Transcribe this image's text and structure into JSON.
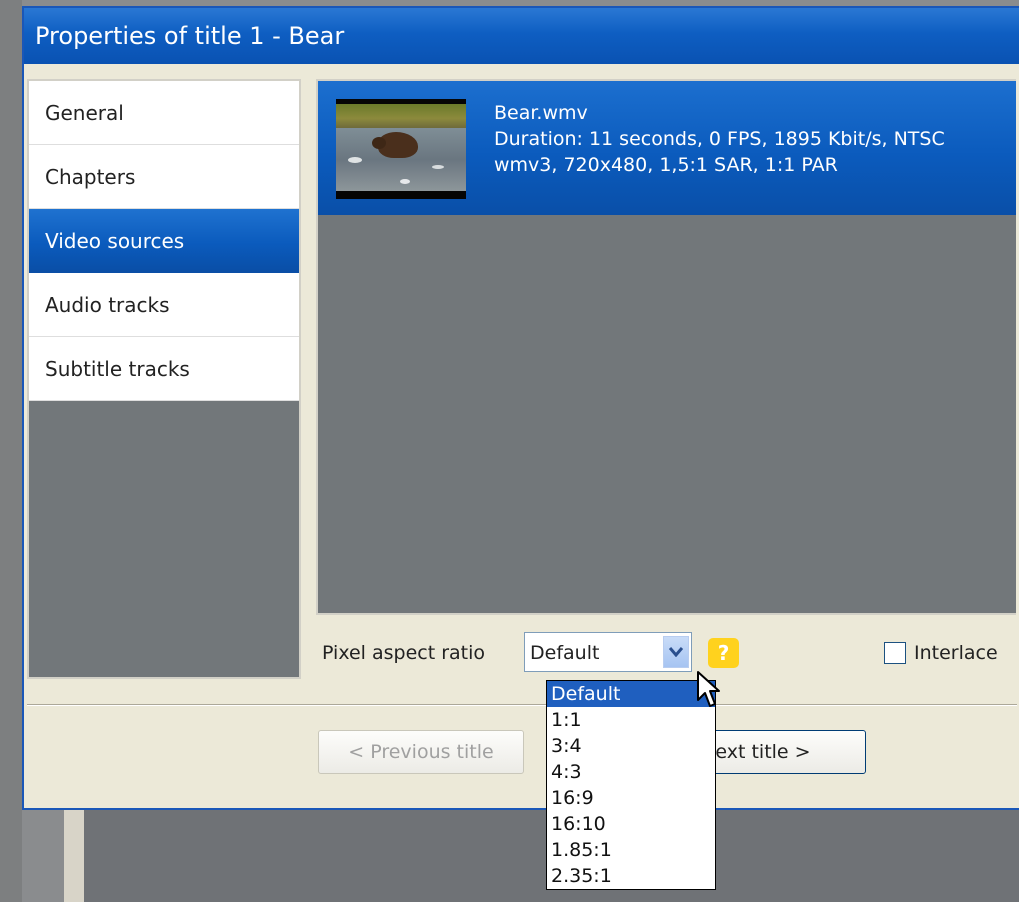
{
  "window": {
    "title": "Properties of title 1 - Bear"
  },
  "nav": {
    "items": [
      {
        "label": "General"
      },
      {
        "label": "Chapters"
      },
      {
        "label": "Video sources",
        "active": true
      },
      {
        "label": "Audio tracks"
      },
      {
        "label": "Subtitle tracks"
      }
    ]
  },
  "source": {
    "filename": "Bear.wmv",
    "details": "Duration: 11 seconds, 0 FPS, 1895 Kbit/s, NTSC",
    "format": "wmv3, 720x480, 1,5:1 SAR, 1:1 PAR"
  },
  "controls": {
    "pixel_aspect_label": "Pixel aspect ratio",
    "pixel_aspect_value": "Default",
    "help_label": "?",
    "interlaced_label": "Interlace",
    "interlaced_checked": false,
    "dropdown_options": [
      "Default",
      "1:1",
      "3:4",
      "4:3",
      "16:9",
      "16:10",
      "1.85:1",
      "2.35:1"
    ],
    "selected_option": "Default"
  },
  "buttons": {
    "previous_title": "< Previous title",
    "next_title": "ext title >"
  },
  "colors": {
    "accent_blue": "#0b5bbd",
    "panel_gray": "#72777a",
    "dialog_bg": "#ece9d8",
    "help_yellow": "#ffd21e"
  }
}
